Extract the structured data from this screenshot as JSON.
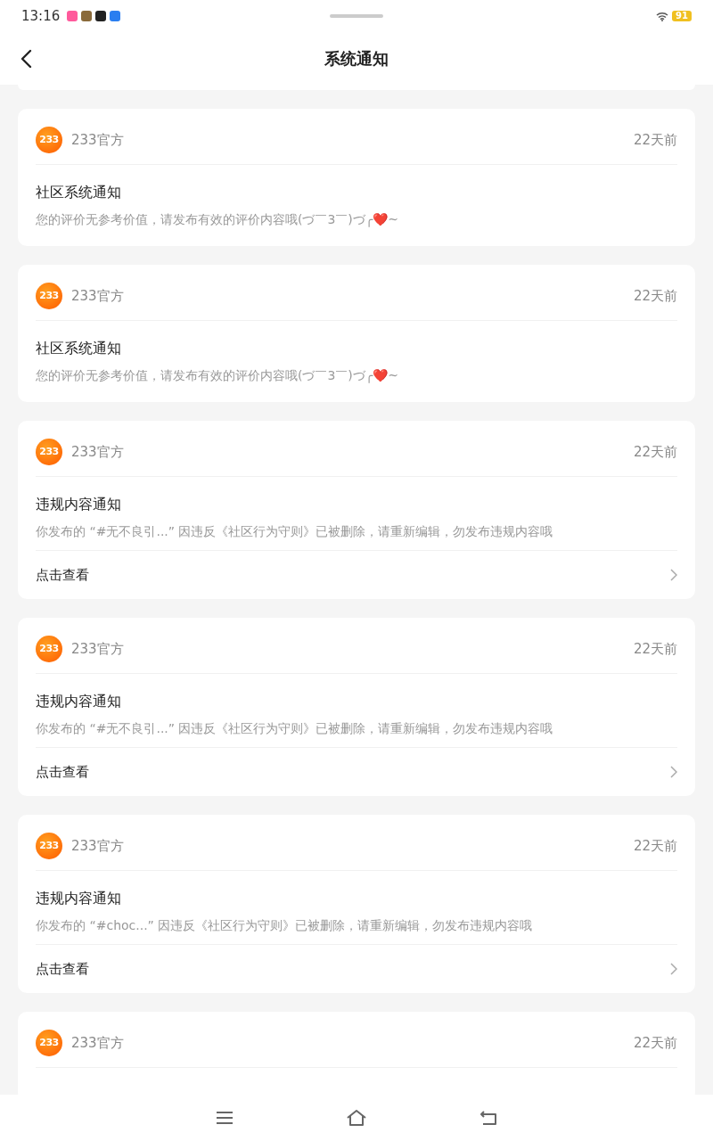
{
  "status_bar": {
    "time": "13:16",
    "battery": "91"
  },
  "header": {
    "title": "系统通知"
  },
  "notifications": [
    {
      "logo_text": "233",
      "sender": "233官方",
      "time": "22天前",
      "title": "社区系统通知",
      "body": "您的评价无参考价值，请发布有效的评价内容哦(づ￣3￣)づ╭❤️~"
    },
    {
      "logo_text": "233",
      "sender": "233官方",
      "time": "22天前",
      "title": "社区系统通知",
      "body": "您的评价无参考价值，请发布有效的评价内容哦(づ￣3￣)づ╭❤️~"
    },
    {
      "logo_text": "233",
      "sender": "233官方",
      "time": "22天前",
      "title": "违规内容通知",
      "body": "你发布的 “#无不良引...” 因违反《社区行为守则》已被删除，请重新编辑，勿发布违规内容哦",
      "link": "点击查看"
    },
    {
      "logo_text": "233",
      "sender": "233官方",
      "time": "22天前",
      "title": "违规内容通知",
      "body": "你发布的 “#无不良引...” 因违反《社区行为守则》已被删除，请重新编辑，勿发布违规内容哦",
      "link": "点击查看"
    },
    {
      "logo_text": "233",
      "sender": "233官方",
      "time": "22天前",
      "title": "违规内容通知",
      "body": "你发布的 “#choc...” 因违反《社区行为守则》已被删除，请重新编辑，勿发布违规内容哦",
      "link": "点击查看"
    },
    {
      "logo_text": "233",
      "sender": "233官方",
      "time": "22天前"
    }
  ]
}
